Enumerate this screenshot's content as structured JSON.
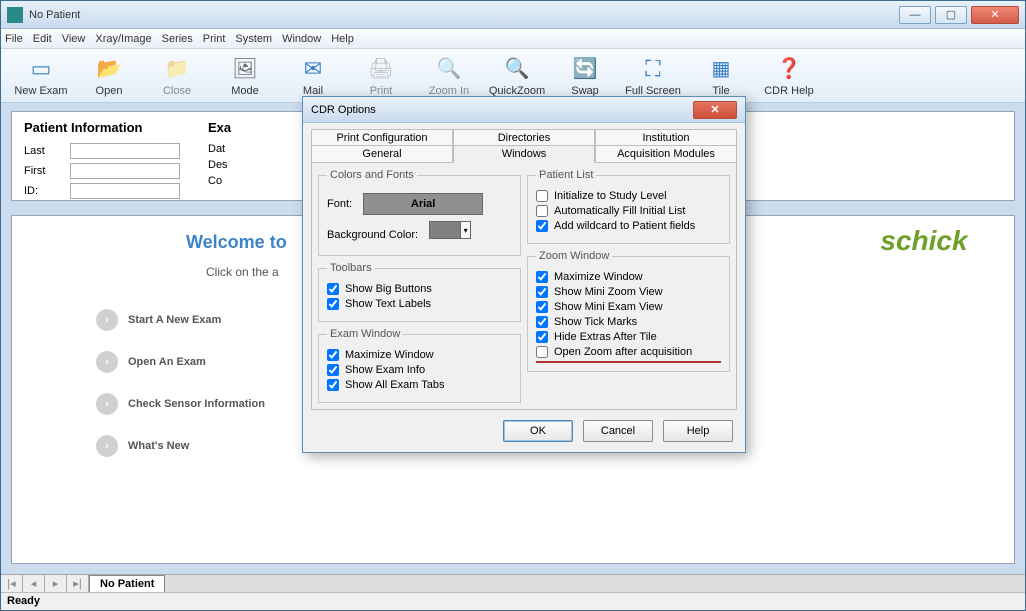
{
  "app": {
    "title": "No Patient"
  },
  "menu": {
    "items": [
      "File",
      "Edit",
      "View",
      "Xray/Image",
      "Series",
      "Print",
      "System",
      "Window",
      "Help"
    ]
  },
  "toolbar": {
    "items": [
      {
        "label": "New Exam",
        "icon": "new",
        "disabled": false
      },
      {
        "label": "Open",
        "icon": "open",
        "disabled": false
      },
      {
        "label": "Close",
        "icon": "close",
        "disabled": true
      },
      {
        "label": "Mode",
        "icon": "mode",
        "disabled": false
      },
      {
        "label": "Mail",
        "icon": "mail",
        "disabled": false
      },
      {
        "label": "Print",
        "icon": "print",
        "disabled": true
      },
      {
        "label": "Zoom In",
        "icon": "zoomin",
        "disabled": true
      },
      {
        "label": "QuickZoom",
        "icon": "qzoom",
        "disabled": false
      },
      {
        "label": "Swap",
        "icon": "swap",
        "disabled": false
      },
      {
        "label": "Full Screen",
        "icon": "full",
        "disabled": false
      },
      {
        "label": "Tile",
        "icon": "tile",
        "disabled": false
      },
      {
        "label": "CDR Help",
        "icon": "help",
        "disabled": false
      }
    ]
  },
  "patientPanel": {
    "title": "Patient Information",
    "examTitle": "Exa",
    "fields": {
      "last": "Last",
      "first": "First",
      "id": "ID:",
      "date": "Dat",
      "desc": "Des",
      "com": "Co"
    }
  },
  "welcome": {
    "title": "Welcome to",
    "sub": "Click on the a",
    "links": [
      "Start A New Exam",
      "Open An Exam",
      "Check Sensor Information",
      "What's New"
    ],
    "logo": "schick"
  },
  "tabstrip": {
    "doc": "No Patient"
  },
  "status": {
    "text": "Ready"
  },
  "dialog": {
    "title": "CDR Options",
    "tabs": {
      "row1": [
        "Print Configuration",
        "Directories",
        "Institution"
      ],
      "row2": [
        "General",
        "Windows",
        "Acquisition Modules"
      ],
      "active": "Windows"
    },
    "colorsFonts": {
      "legend": "Colors and Fonts",
      "fontLabel": "Font:",
      "fontName": "Arial",
      "bgLabel": "Background Color:",
      "bgColor": "#808080"
    },
    "toolbars": {
      "legend": "Toolbars",
      "items": [
        {
          "label": "Show Big Buttons",
          "checked": true
        },
        {
          "label": "Show Text Labels",
          "checked": true
        }
      ]
    },
    "examWindow": {
      "legend": "Exam Window",
      "items": [
        {
          "label": "Maximize Window",
          "checked": true
        },
        {
          "label": "Show Exam Info",
          "checked": true
        },
        {
          "label": "Show All Exam Tabs",
          "checked": true
        }
      ]
    },
    "patientList": {
      "legend": "Patient List",
      "items": [
        {
          "label": "Initialize to Study Level",
          "checked": false
        },
        {
          "label": "Automatically Fill Initial List",
          "checked": false
        },
        {
          "label": "Add wildcard to Patient fields",
          "checked": true
        }
      ]
    },
    "zoomWindow": {
      "legend": "Zoom Window",
      "items": [
        {
          "label": "Maximize Window",
          "checked": true
        },
        {
          "label": "Show Mini Zoom View",
          "checked": true
        },
        {
          "label": "Show Mini Exam View",
          "checked": true
        },
        {
          "label": "Show Tick Marks",
          "checked": true
        },
        {
          "label": "Hide Extras After Tile",
          "checked": true
        },
        {
          "label": "Open Zoom after acquisition",
          "checked": false
        }
      ]
    },
    "buttons": {
      "ok": "OK",
      "cancel": "Cancel",
      "help": "Help"
    }
  }
}
